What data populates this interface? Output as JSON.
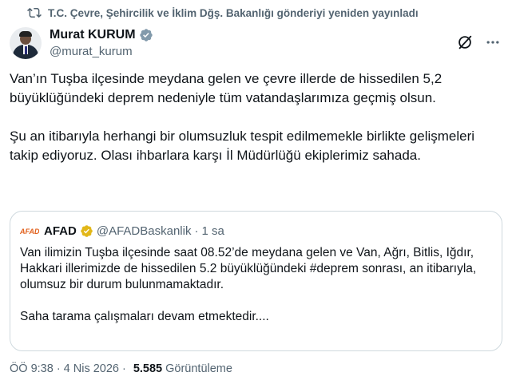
{
  "repost": {
    "icon": "repost-icon",
    "text": "T.C. Çevre, Şehircilik ve İklim Dğş. Bakanlığı gönderiyi yeniden yayınladı"
  },
  "author": {
    "display_name": "Murat KURUM",
    "handle": "@murat_kurum",
    "verified_color": "#829aab"
  },
  "tweet": {
    "paragraphs": [
      "Van’ın Tuşba ilçesinde meydana gelen ve çevre illerde de hissedilen 5,2 büyüklüğündeki deprem nedeniyle tüm vatandaşlarımıza geçmiş olsun.",
      "Şu an itibarıyla herhangi bir olumsuzluk tespit edilmemekle birlikte gelişmeleri takip ediyoruz. Olası ihbarlara karşı İl Müdürlüğü ekiplerimiz sahada."
    ]
  },
  "quote": {
    "logo_text": "AFAD",
    "display_name": "AFAD",
    "handle": "@AFADBaskanlik",
    "separator": "·",
    "time": "1 sa",
    "verified_color": "#e2b719",
    "paragraphs": [
      "Van ilimizin Tuşba ilçesinde saat 08.52’de meydana gelen ve Van, Ağrı, Bitlis, Iğdır, Hakkari illerimizde de hissedilen 5.2 büyüklüğündeki #deprem sonrası, an itibarıyla, olumsuz bir durum bulunmamaktadır.",
      "Saha tarama çalışmaları devam etmektedir...."
    ]
  },
  "meta": {
    "time": "ÖÖ 9:38",
    "separator": "·",
    "date": "4 Nis 2026",
    "separator2": "·",
    "views": "5.585",
    "views_label": "Görüntüleme"
  },
  "colors": {
    "text": "#0f1419",
    "secondary": "#536471",
    "border": "#cfd9de"
  }
}
